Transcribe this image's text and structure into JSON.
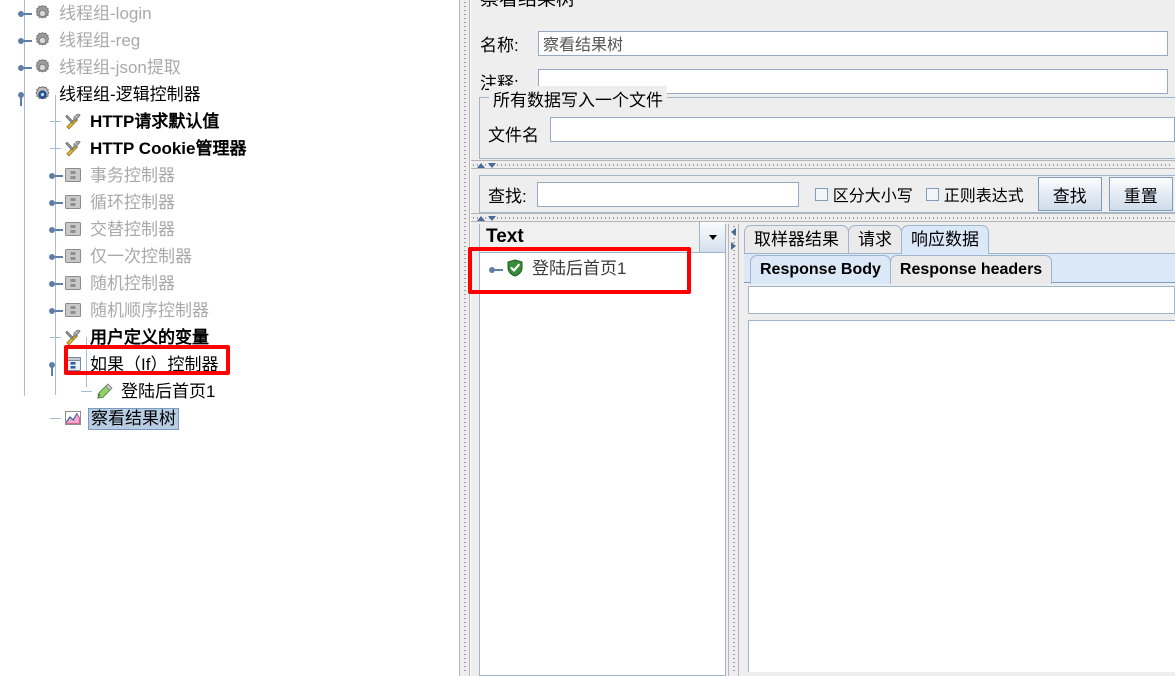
{
  "tree": {
    "name": "test-plan-tree",
    "items": [
      {
        "label": "线程组-login",
        "icon": "gear-icon",
        "state": "dim",
        "depth": 1,
        "handle": "collapsed"
      },
      {
        "label": "线程组-reg",
        "icon": "gear-icon",
        "state": "dim",
        "depth": 1,
        "handle": "collapsed"
      },
      {
        "label": "线程组-json提取",
        "icon": "gear-icon",
        "state": "dim",
        "depth": 1,
        "handle": "collapsed"
      },
      {
        "label": "线程组-逻辑控制器",
        "icon": "gear-icon",
        "state": "normal",
        "depth": 1,
        "handle": "expanded"
      },
      {
        "label": "HTTP请求默认值",
        "icon": "wrench-icon",
        "state": "normal",
        "depth": 2,
        "handle": "leaf"
      },
      {
        "label": "HTTP Cookie管理器",
        "icon": "wrench-icon",
        "state": "normal",
        "depth": 2,
        "handle": "leaf"
      },
      {
        "label": "事务控制器",
        "icon": "controller-icon",
        "state": "dim",
        "depth": 2,
        "handle": "collapsed"
      },
      {
        "label": "循环控制器",
        "icon": "controller-icon",
        "state": "dim",
        "depth": 2,
        "handle": "collapsed"
      },
      {
        "label": "交替控制器",
        "icon": "controller-icon",
        "state": "dim",
        "depth": 2,
        "handle": "collapsed"
      },
      {
        "label": "仅一次控制器",
        "icon": "controller-icon",
        "state": "dim",
        "depth": 2,
        "handle": "collapsed"
      },
      {
        "label": "随机控制器",
        "icon": "controller-icon",
        "state": "dim",
        "depth": 2,
        "handle": "collapsed"
      },
      {
        "label": "随机顺序控制器",
        "icon": "controller-icon",
        "state": "dim",
        "depth": 2,
        "handle": "collapsed"
      },
      {
        "label": "用户定义的变量",
        "icon": "wrench-icon",
        "state": "normal",
        "depth": 2,
        "handle": "leaf"
      },
      {
        "label": "如果（If）控制器",
        "icon": "if-controller-icon",
        "state": "normal",
        "depth": 2,
        "handle": "expanded"
      },
      {
        "label": "登陆后首页1",
        "icon": "sampler-icon",
        "state": "normal",
        "depth": 3,
        "handle": "leaf",
        "highlight": "red"
      },
      {
        "label": "察看结果树",
        "icon": "view-results-tree-icon",
        "state": "selected",
        "depth": 2,
        "handle": "leaf"
      }
    ]
  },
  "panel": {
    "title": "察看结果树",
    "name_label": "名称:",
    "name_value": "察看结果树",
    "comment_label": "注释:",
    "comment_value": "",
    "file_group_title": "所有数据写入一个文件",
    "filename_label": "文件名",
    "filename_value": ""
  },
  "search": {
    "label": "查找:",
    "value": "",
    "case_sensitive_label": "区分大小写",
    "case_sensitive_checked": false,
    "regex_label": "正则表达式",
    "regex_checked": false,
    "find_button": "查找",
    "reset_button": "重置"
  },
  "results": {
    "render_selector_value": "Text",
    "render_selector_icon": "chevron-down-icon",
    "entries": [
      {
        "label": "登陆后首页1",
        "status": "success",
        "status_icon": "green-shield-check-icon"
      }
    ]
  },
  "tabs": {
    "outer": [
      {
        "label": "取样器结果",
        "active": false
      },
      {
        "label": "请求",
        "active": false
      },
      {
        "label": "响应数据",
        "active": true
      }
    ],
    "inner": [
      {
        "label": "Response Body",
        "active": true
      },
      {
        "label": "Response headers",
        "active": false
      }
    ]
  },
  "response": {
    "filter_value": "",
    "body_value": ""
  },
  "colors": {
    "accent": "#b8cce4",
    "annotation": "#fe0000",
    "panel_bg": "#eeeeee",
    "border": "#9fb4cd",
    "tab_active": "#dbe8f7",
    "dim_text": "#a9a9a9"
  }
}
